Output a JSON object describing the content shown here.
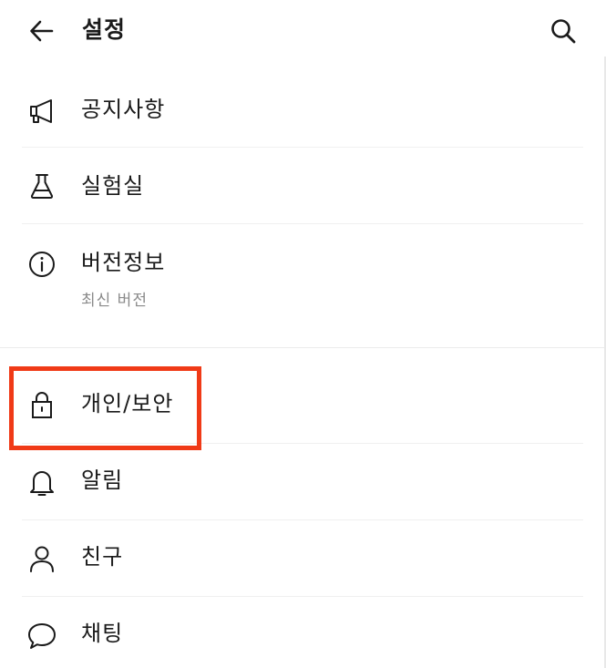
{
  "header": {
    "title": "설정",
    "back_icon": "arrow-left-icon",
    "search_icon": "search-icon"
  },
  "items": [
    {
      "label": "공지사항",
      "icon": "megaphone-icon"
    },
    {
      "label": "실험실",
      "icon": "flask-icon"
    },
    {
      "label": "버전정보",
      "sub": "최신 버전",
      "icon": "info-icon"
    },
    {
      "label": "개인/보안",
      "icon": "lock-icon",
      "highlighted": true
    },
    {
      "label": "알림",
      "icon": "bell-icon"
    },
    {
      "label": "친구",
      "icon": "person-icon"
    },
    {
      "label": "채팅",
      "icon": "chat-bubble-icon"
    }
  ],
  "colors": {
    "highlight": "#f03a17",
    "text": "#1a1a1a",
    "subtext": "#8a8a8a",
    "divider": "#f0f0f0"
  }
}
